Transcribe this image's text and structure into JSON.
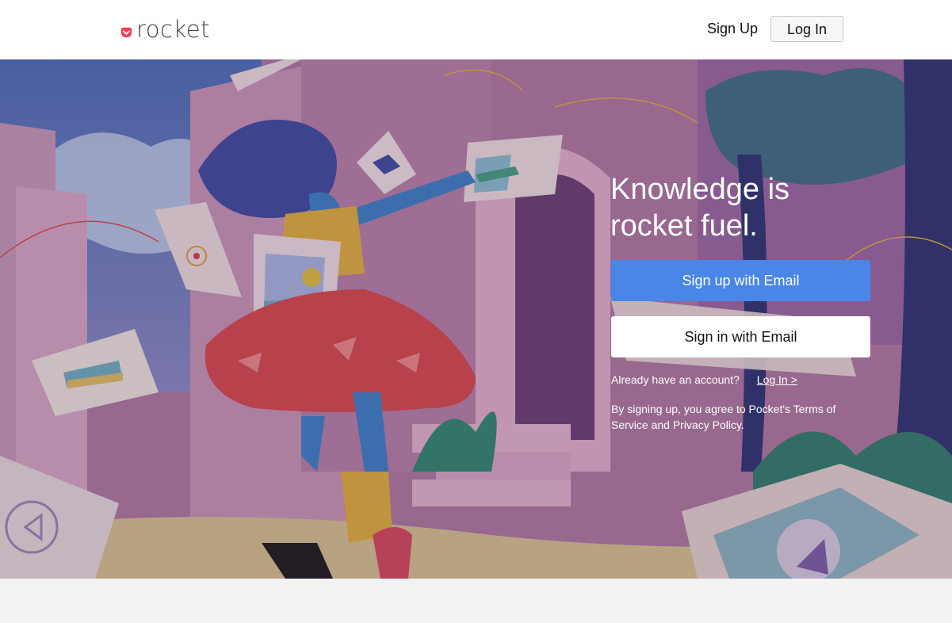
{
  "header": {
    "logo_text": "rocket",
    "logo_icon": "pocket-icon",
    "signup_label": "Sign Up",
    "login_label": "Log In"
  },
  "hero": {
    "headline": "Knowledge is rocket fuel.",
    "signup_email_label": "Sign up with Email",
    "signin_email_label": "Sign in with Email",
    "account_prompt": "Already have an account?",
    "account_link": "Log In >",
    "terms": "By signing up, you agree to Pocket's Terms of Service and Privacy Policy."
  },
  "colors": {
    "brand": "#ef4056",
    "primary_button": "#4a86e8"
  }
}
